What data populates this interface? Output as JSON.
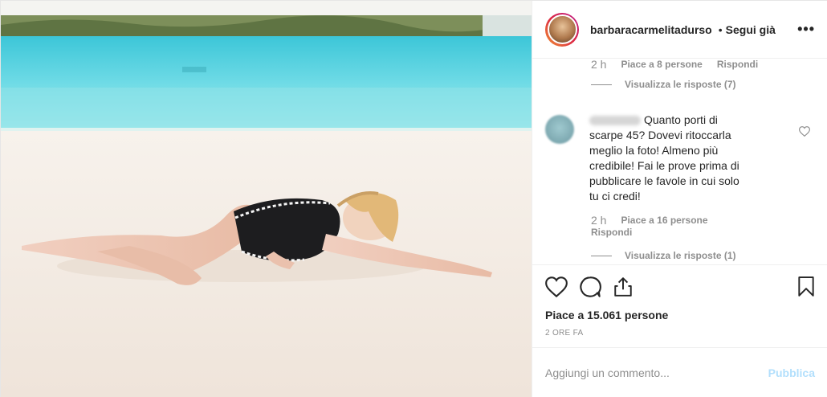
{
  "header": {
    "username": "barbaracarmelitadurso",
    "separator": "•",
    "follow_status": "Segui già",
    "more_icon": "more-options-icon"
  },
  "comments": {
    "previous": {
      "time": "2 h",
      "likes": "Piace a 8 persone",
      "reply": "Rispondi",
      "view_replies": "Visualizza le risposte (7)"
    },
    "current": {
      "text": "Quanto porti di scarpe 45? Dovevi ritoccarla meglio la foto! Almeno più credibile! Fai le prove prima di pubblicare le favole in cui solo tu ci credi!",
      "time": "2 h",
      "likes": "Piace a 16 persone",
      "reply": "Rispondi",
      "view_replies": "Visualizza le risposte (1)"
    }
  },
  "actions": {
    "icons": [
      "heart-icon",
      "comment-icon",
      "share-icon",
      "bookmark-icon"
    ],
    "likes_count": "Piace a 15.061 persone",
    "date": "2 ORE FA"
  },
  "add_comment": {
    "placeholder": "Aggiungi un commento...",
    "publish": "Pubblica"
  },
  "colors": {
    "pool_water": "#5fd3e0",
    "pool_deck": "#f3ebe3",
    "link_disabled": "#b2dffc",
    "muted_text": "#8e8e8e"
  }
}
